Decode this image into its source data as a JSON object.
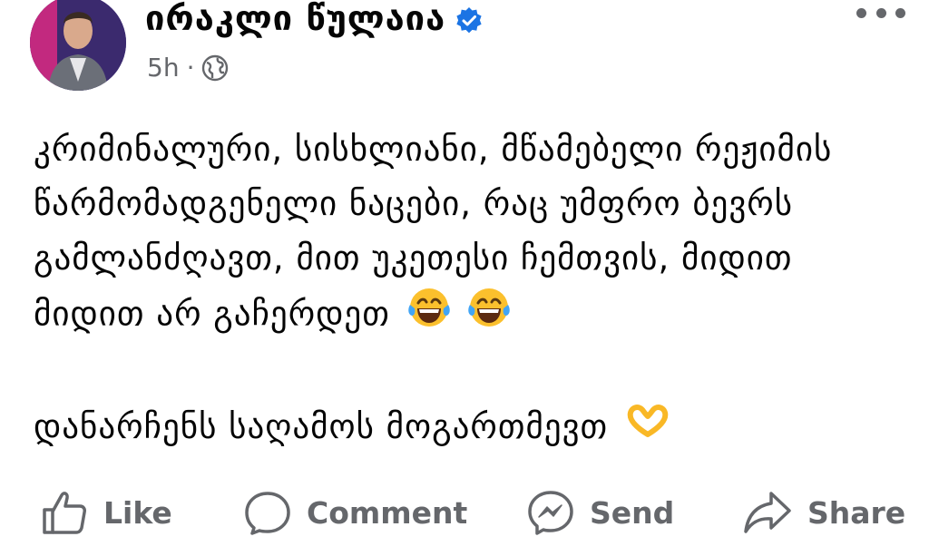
{
  "post": {
    "author": "ირაკლი წულაია",
    "time": "5h",
    "separator": "·",
    "paragraph1": "კრიმინალური, სისხლიანი, მწამებელი რეჟიმის წარმომადგენელი ნაცები, რაც უმფრო ბევრს გამლანძღავთ, მით უკეთესი ჩემთვის, მიდით მიდით არ გაჩერდეთ",
    "paragraph2": "დანარჩენს საღამოს მოგართმევთ"
  },
  "icons": {
    "verified": "verified-badge-icon",
    "privacy": "globe-icon",
    "more": "more-options-icon",
    "emoji1": "laughing-tears-emoji",
    "emoji2": "heart-hands-emoji"
  },
  "actions": {
    "like": "Like",
    "comment": "Comment",
    "send": "Send",
    "share": "Share"
  },
  "colors": {
    "accent": "#1b74e4",
    "secondary_text": "#65676b",
    "text": "#050505"
  }
}
